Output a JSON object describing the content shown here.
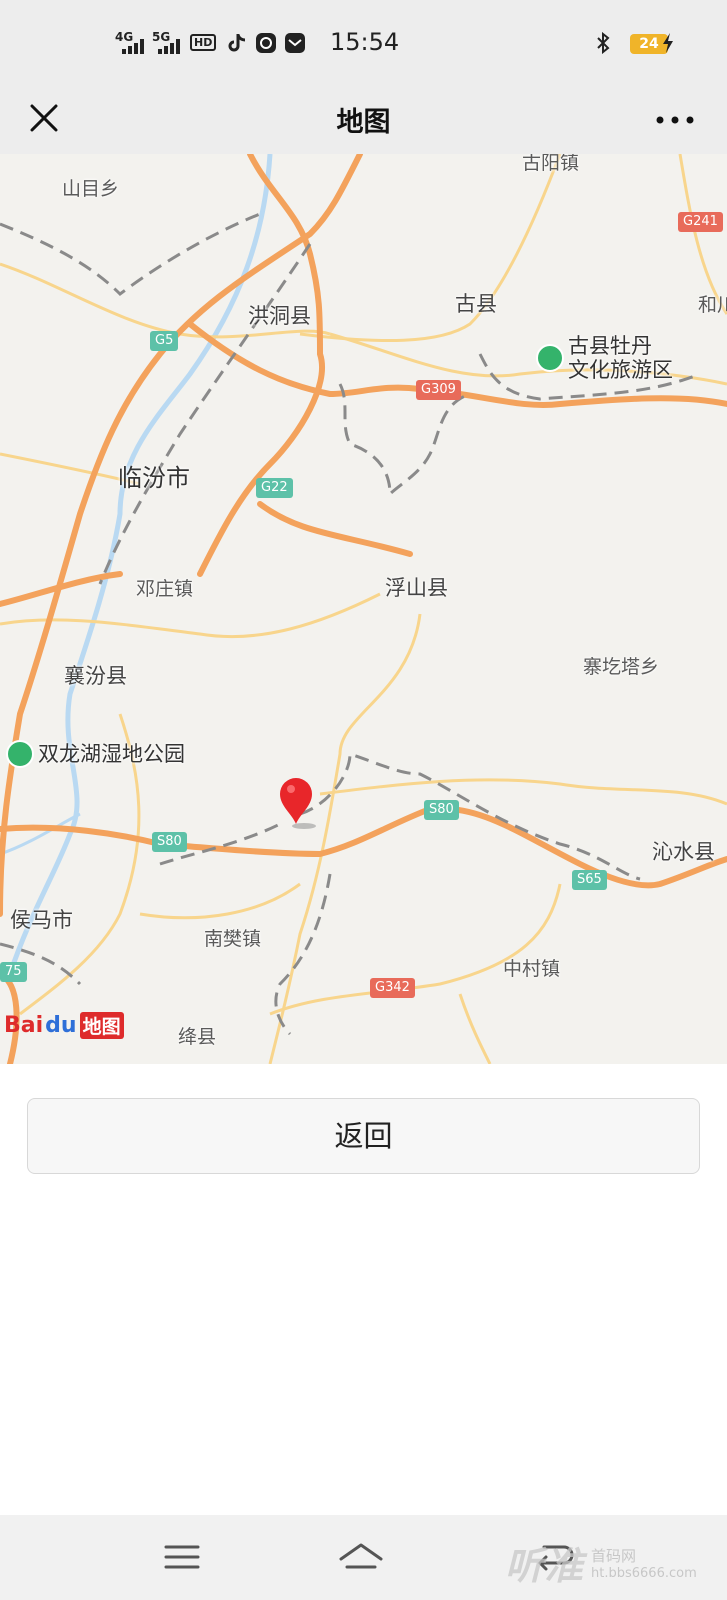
{
  "status_bar": {
    "time": "15:54",
    "signal_1": "4G",
    "signal_2": "5G",
    "hd_label": "HD",
    "battery_level": "24",
    "icons": [
      "signal-icon",
      "signal-icon",
      "hd-voice-icon",
      "tiktok-icon",
      "media-icon",
      "mail-icon",
      "bluetooth-icon",
      "battery-icon",
      "charging-icon"
    ]
  },
  "nav": {
    "title": "地图",
    "left_icon": "close-icon",
    "right_icon": "more-icon"
  },
  "map": {
    "places": {
      "shanmu": "山目乡",
      "guyang": "古阳镇",
      "hongdong": "洪洞县",
      "guxian": "古县",
      "hezhou": "和川",
      "linfen": "临汾市",
      "dengzhuang": "邓庄镇",
      "fushan": "浮山县",
      "saigeta": "寨圪塔乡",
      "xiangfen": "襄汾县",
      "houma": "侯马市",
      "nanfan": "南樊镇",
      "qinshui": "沁水县",
      "zhongcun": "中村镇",
      "jiangxian": "绛县"
    },
    "pois": {
      "peony_line1": "古县牡丹",
      "peony_line2": "文化旅游区",
      "wetland": "双龙湖湿地公园"
    },
    "shields": {
      "g5": "G5",
      "g241": "G241",
      "g309": "G309",
      "g22": "G22",
      "s80a": "S80",
      "s80b": "S80",
      "s65": "S65",
      "g342": "G342",
      "g75": "75"
    },
    "logo": {
      "bai": "Bai",
      "du": "du",
      "ditu": "地图"
    },
    "colors": {
      "highway": "#f3a25c",
      "road": "#f8d58c",
      "rail": "#8a8a8a",
      "river": "#b9d9f2",
      "pin": "#e8262a"
    }
  },
  "back_button": {
    "label": "返回"
  },
  "bottom_nav": {
    "icons": [
      "menu-icon",
      "home-icon",
      "back-icon"
    ],
    "watermark_main": "听准",
    "watermark_title": "首码网",
    "watermark_url": "ht.bbs6666.com"
  }
}
